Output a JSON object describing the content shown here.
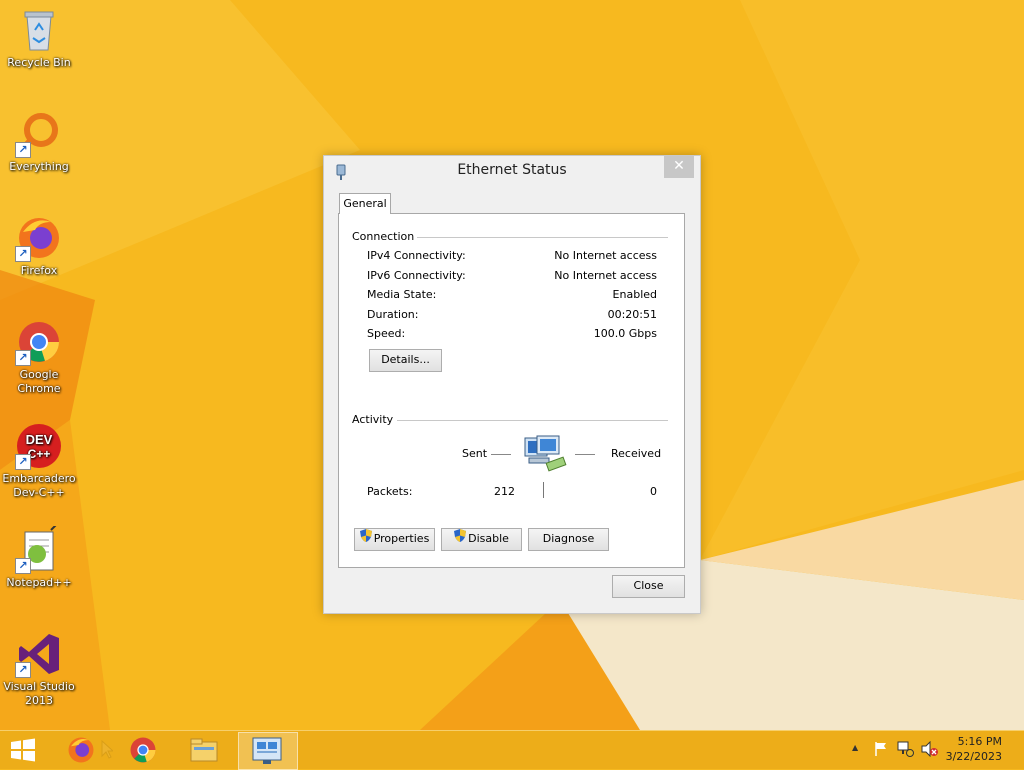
{
  "desktop": {
    "icons": [
      {
        "label": "Recycle Bin",
        "icon": "recycle-bin-icon"
      },
      {
        "label": "Everything",
        "icon": "everything-search-icon"
      },
      {
        "label": "Firefox",
        "icon": "firefox-icon"
      },
      {
        "label": "Google Chrome",
        "icon": "chrome-icon"
      },
      {
        "label": "Embarcadero Dev-C++",
        "icon": "devcpp-icon"
      },
      {
        "label": "Notepad++",
        "icon": "notepadpp-icon"
      },
      {
        "label": "Visual Studio 2013",
        "icon": "visual-studio-icon"
      }
    ],
    "devcpp_logo_top": "DEV",
    "devcpp_logo_bottom": "C++"
  },
  "dialog": {
    "title": "Ethernet Status",
    "close_glyph": "✕",
    "tab": "General",
    "connection": {
      "heading": "Connection",
      "rows": [
        {
          "label": "IPv4 Connectivity:",
          "value": "No Internet access"
        },
        {
          "label": "IPv6 Connectivity:",
          "value": "No Internet access"
        },
        {
          "label": "Media State:",
          "value": "Enabled"
        },
        {
          "label": "Duration:",
          "value": "00:20:51"
        },
        {
          "label": "Speed:",
          "value": "100.0 Gbps"
        }
      ],
      "details_button": "Details..."
    },
    "activity": {
      "heading": "Activity",
      "sent_label": "Sent",
      "received_label": "Received",
      "packets_label": "Packets:",
      "packets_sent": "212",
      "packets_received": "0"
    },
    "buttons": {
      "properties": "Properties",
      "disable": "Disable",
      "diagnose": "Diagnose",
      "close": "Close"
    }
  },
  "taskbar": {
    "items": [
      "start-icon",
      "firefox-icon",
      "chrome-icon",
      "file-explorer-icon",
      "network-connections-icon"
    ],
    "tray_up_glyph": "▲",
    "time": "5:16 PM",
    "date": "3/22/2023"
  },
  "colors": {
    "desktop": "#f6b81f",
    "taskbar": "#ebab19",
    "dialog": "#f0f0f0"
  }
}
